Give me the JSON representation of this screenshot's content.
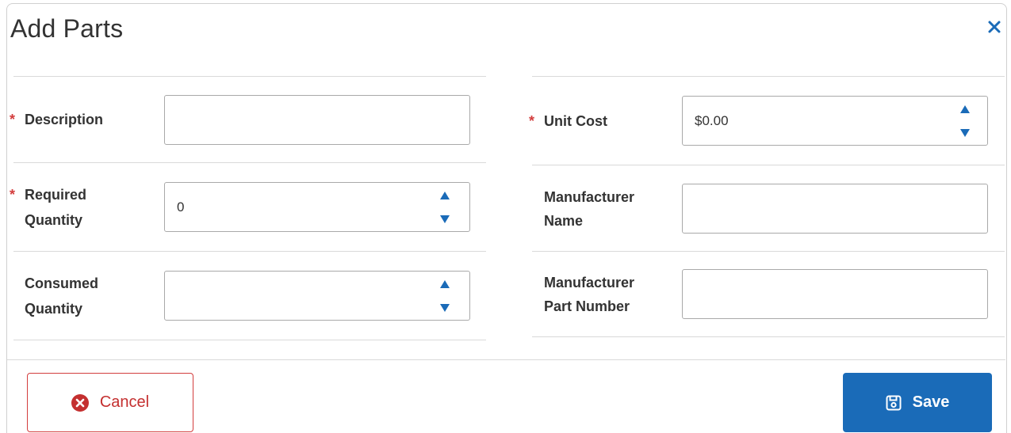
{
  "dialog": {
    "title": "Add Parts",
    "close_icon": "close-icon"
  },
  "left_fields": {
    "description": {
      "label": "Description",
      "required": "*",
      "value": ""
    },
    "required_quantity": {
      "label_line1": "Required",
      "label_line2": "Quantity",
      "required": "*",
      "value": "0"
    },
    "consumed_quantity": {
      "label_line1": "Consumed",
      "label_line2": "Quantity",
      "value": ""
    }
  },
  "right_fields": {
    "unit_cost": {
      "label": "Unit Cost",
      "required": "*",
      "value": "$0.00"
    },
    "manufacturer_name": {
      "label_line1": "Manufacturer",
      "label_line2": "Name",
      "value": ""
    },
    "manufacturer_part_number": {
      "label_line1": "Manufacturer",
      "label_line2": "Part Number",
      "value": ""
    }
  },
  "footer": {
    "cancel_label": "Cancel",
    "save_label": "Save"
  },
  "colors": {
    "accent": "#1a6bb8",
    "required": "#d33d3d",
    "cancel": "#c42f2f",
    "spinner": "#1a6bb8"
  }
}
